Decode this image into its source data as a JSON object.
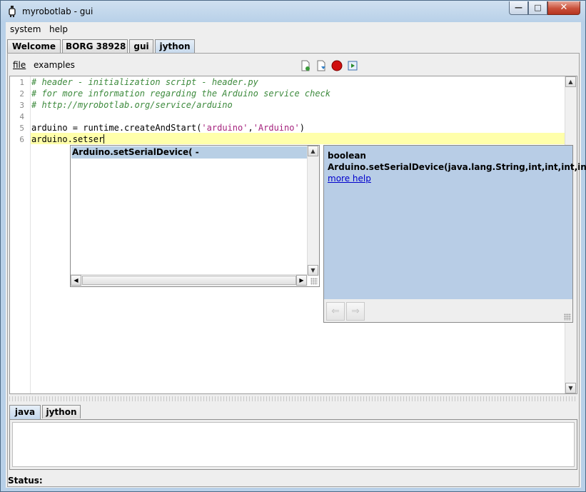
{
  "window": {
    "title": "myrobotlab - gui"
  },
  "menubar": {
    "items": [
      "system",
      "help"
    ]
  },
  "tabs": [
    "Welcome",
    "BORG 38928",
    "gui",
    "jython"
  ],
  "editor_toolbar": {
    "file_menu": "file",
    "examples_menu": "examples"
  },
  "editor": {
    "line_numbers": [
      "1",
      "2",
      "3",
      "4",
      "5",
      "6"
    ],
    "lines": [
      "# header - initialization script - header.py",
      "# for more information regarding the Arduino service check",
      "# http://myrobotlab.org/service/arduino",
      "",
      {
        "pre": "arduino = runtime.createAndStart(",
        "s1": "'arduino'",
        "mid": ",",
        "s2": "'Arduino'",
        "post": ")"
      },
      "arduino.setser"
    ]
  },
  "autocomplete": {
    "selected": "Arduino.setSerialDevice( -",
    "desc_return": "boolean",
    "desc_signature": "Arduino.setSerialDevice(java.lang.String,int,int,int,int)",
    "desc_link": "more help"
  },
  "output_tabs": [
    "java",
    "jython"
  ],
  "status": {
    "label": "Status:"
  },
  "colors": {
    "comment": "#3d8a3d",
    "string": "#a5227d",
    "current_line": "#ffffaa",
    "selection": "#b8cfe5"
  }
}
